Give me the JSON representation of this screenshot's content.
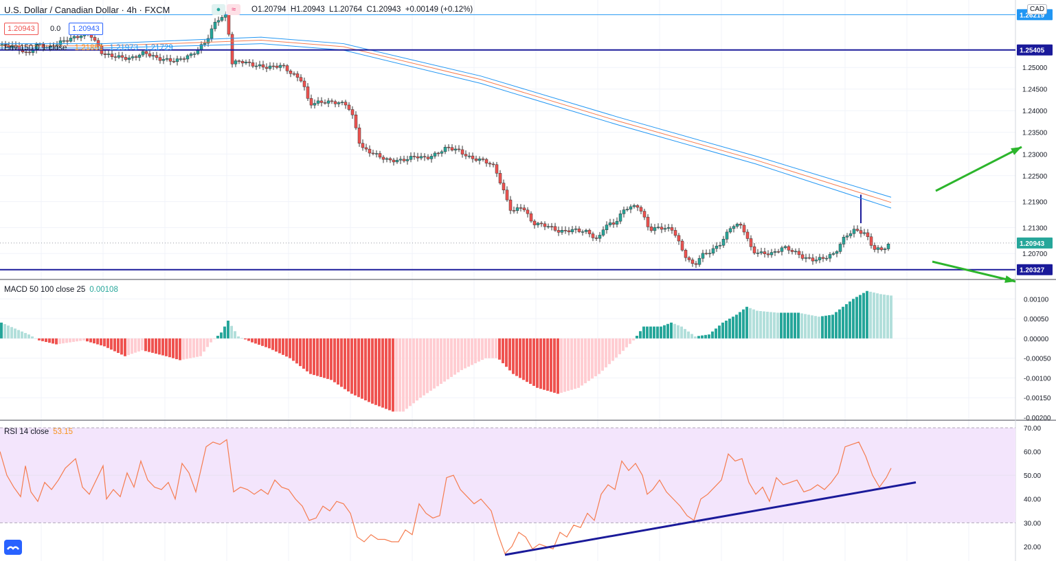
{
  "header": {
    "title": "U.S. Dollar / Canadian Dollar · 4h · FXCM",
    "ohlc_open": "O1.20794",
    "ohlc_high": "H1.20943",
    "ohlc_low": "L1.20764",
    "ohlc_close": "C1.20943",
    "ohlc_change": "+0.00149 (+0.12%)",
    "sell_price": "1.20943",
    "spread": "0.0",
    "buy_price": "1.20943",
    "currency": "CAD"
  },
  "envelope_legend": {
    "label": "Env 150 0.1 close",
    "basis": "1.21851",
    "upper": "1.21973",
    "lower": "1.21729"
  },
  "macd_legend": {
    "label": "MACD 50 100 close 25",
    "value": "0.00108"
  },
  "rsi_legend": {
    "label": "RSI 14 close",
    "value": "53.15"
  },
  "colors": {
    "up": "#26a69a",
    "down": "#ef5350",
    "upper_band": "#2196f3",
    "basis": "#f57c4f",
    "hline_blue": "#1a1a9a",
    "hline_light": "#2196f3",
    "arrow": "#2cb52c",
    "macd_up_strong": "#26a69a",
    "macd_up_weak": "#b2dfdb",
    "macd_down_strong": "#ef5350",
    "macd_down_weak": "#ffcdd2",
    "rsi_line": "#f57c4f",
    "rsi_band": "#f3e5fc",
    "trendline": "#1a1a9a"
  },
  "chart_data": [
    {
      "type": "candlestick",
      "title": "U.S. Dollar / Canadian Dollar · 4h · FXCM",
      "y_axis_ticks": [
        "1.26219",
        "1.25405",
        "1.25000",
        "1.24500",
        "1.24000",
        "1.23500",
        "1.23000",
        "1.22500",
        "1.21900",
        "1.21300",
        "1.20943",
        "1.20700",
        "1.20327"
      ],
      "ylim": [
        1.201,
        1.264
      ],
      "horizontal_levels": [
        {
          "label": "1.26219",
          "value": 1.26219,
          "style": "thin-blue"
        },
        {
          "label": "1.25405",
          "value": 1.25405,
          "style": "thick-navy"
        },
        {
          "label": "1.20327",
          "value": 1.20327,
          "style": "thick-navy"
        }
      ],
      "last_price": "1.20943",
      "close_path": [
        [
          0,
          1.255
        ],
        [
          20,
          1.255
        ],
        [
          40,
          1.253
        ],
        [
          55,
          1.2555
        ],
        [
          70,
          1.2545
        ],
        [
          90,
          1.256
        ],
        [
          110,
          1.257
        ],
        [
          130,
          1.258
        ],
        [
          150,
          1.253
        ],
        [
          170,
          1.2525
        ],
        [
          190,
          1.252
        ],
        [
          210,
          1.2535
        ],
        [
          230,
          1.252
        ],
        [
          255,
          1.2515
        ],
        [
          280,
          1.253
        ],
        [
          300,
          1.256
        ],
        [
          315,
          1.261
        ],
        [
          330,
          1.262
        ],
        [
          338,
          1.251
        ],
        [
          350,
          1.2515
        ],
        [
          370,
          1.2505
        ],
        [
          390,
          1.25
        ],
        [
          410,
          1.2505
        ],
        [
          425,
          1.2485
        ],
        [
          440,
          1.247
        ],
        [
          450,
          1.2415
        ],
        [
          465,
          1.242
        ],
        [
          485,
          1.242
        ],
        [
          505,
          1.2415
        ],
        [
          515,
          1.238
        ],
        [
          525,
          1.2315
        ],
        [
          545,
          1.23
        ],
        [
          565,
          1.2285
        ],
        [
          585,
          1.2285
        ],
        [
          605,
          1.2295
        ],
        [
          620,
          1.229
        ],
        [
          635,
          1.23
        ],
        [
          650,
          1.2315
        ],
        [
          665,
          1.231
        ],
        [
          685,
          1.229
        ],
        [
          705,
          1.2285
        ],
        [
          720,
          1.227
        ],
        [
          735,
          1.2205
        ],
        [
          745,
          1.2165
        ],
        [
          760,
          1.218
        ],
        [
          775,
          1.214
        ],
        [
          795,
          1.2135
        ],
        [
          815,
          1.212
        ],
        [
          835,
          1.2125
        ],
        [
          855,
          1.212
        ],
        [
          870,
          1.21
        ],
        [
          880,
          1.2135
        ],
        [
          895,
          1.214
        ],
        [
          910,
          1.2175
        ],
        [
          930,
          1.218
        ],
        [
          945,
          1.2125
        ],
        [
          960,
          1.213
        ],
        [
          980,
          1.2125
        ],
        [
          995,
          1.207
        ],
        [
          1010,
          1.204
        ],
        [
          1020,
          1.2065
        ],
        [
          1035,
          1.2075
        ],
        [
          1050,
          1.2095
        ],
        [
          1065,
          1.2135
        ],
        [
          1080,
          1.2135
        ],
        [
          1095,
          1.2075
        ],
        [
          1110,
          1.207
        ],
        [
          1125,
          1.207
        ],
        [
          1140,
          1.2085
        ],
        [
          1155,
          1.2075
        ],
        [
          1170,
          1.206
        ],
        [
          1185,
          1.2055
        ],
        [
          1200,
          1.206
        ],
        [
          1215,
          1.207
        ],
        [
          1230,
          1.211
        ],
        [
          1245,
          1.2125
        ],
        [
          1260,
          1.2115
        ],
        [
          1272,
          1.208
        ],
        [
          1285,
          1.208
        ],
        [
          1297,
          1.2094
        ]
      ],
      "envelope": {
        "upper": [
          [
            0,
            1.2555
          ],
          [
            150,
            1.2555
          ],
          [
            300,
            1.2565
          ],
          [
            380,
            1.257
          ],
          [
            500,
            1.2555
          ],
          [
            700,
            1.248
          ],
          [
            900,
            1.2385
          ],
          [
            1100,
            1.2295
          ],
          [
            1297,
            1.22
          ]
        ],
        "basis": [
          [
            0,
            1.255
          ],
          [
            150,
            1.255
          ],
          [
            300,
            1.2558
          ],
          [
            380,
            1.2563
          ],
          [
            500,
            1.2548
          ],
          [
            700,
            1.2472
          ],
          [
            900,
            1.2376
          ],
          [
            1100,
            1.2286
          ],
          [
            1297,
            1.2188
          ]
        ],
        "lower": [
          [
            0,
            1.2545
          ],
          [
            150,
            1.2545
          ],
          [
            300,
            1.2551
          ],
          [
            380,
            1.2555
          ],
          [
            500,
            1.254
          ],
          [
            700,
            1.2463
          ],
          [
            900,
            1.2367
          ],
          [
            1100,
            1.2277
          ],
          [
            1297,
            1.2175
          ]
        ]
      }
    },
    {
      "type": "bar",
      "title": "MACD 50 100 close 25",
      "y_axis_ticks": [
        "0.00100",
        "0.00050",
        "0.00000",
        "-0.00050",
        "-0.00100",
        "-0.00150",
        "-0.00200"
      ],
      "ylim": [
        -0.002,
        0.0013
      ],
      "path": [
        [
          0,
          0.0004
        ],
        [
          40,
          0.0001
        ],
        [
          55,
          -5e-05
        ],
        [
          80,
          -0.00015
        ],
        [
          100,
          -0.0001
        ],
        [
          120,
          -5e-05
        ],
        [
          150,
          -0.0002
        ],
        [
          180,
          -0.00045
        ],
        [
          205,
          -0.0003
        ],
        [
          240,
          -0.00045
        ],
        [
          260,
          -0.00055
        ],
        [
          290,
          -0.00045
        ],
        [
          305,
          -0.0001
        ],
        [
          320,
          0.00015
        ],
        [
          330,
          0.00045
        ],
        [
          345,
          5e-05
        ],
        [
          365,
          -0.0001
        ],
        [
          390,
          -0.00025
        ],
        [
          420,
          -0.0005
        ],
        [
          450,
          -0.0009
        ],
        [
          480,
          -0.00105
        ],
        [
          510,
          -0.0014
        ],
        [
          540,
          -0.00165
        ],
        [
          570,
          -0.00185
        ],
        [
          585,
          -0.00185
        ],
        [
          610,
          -0.0015
        ],
        [
          640,
          -0.00115
        ],
        [
          670,
          -0.0008
        ],
        [
          705,
          -0.0005
        ],
        [
          723,
          -0.0005
        ],
        [
          745,
          -0.0009
        ],
        [
          780,
          -0.00125
        ],
        [
          810,
          -0.0014
        ],
        [
          840,
          -0.00125
        ],
        [
          870,
          -0.0009
        ],
        [
          900,
          -0.0004
        ],
        [
          920,
          -5e-05
        ],
        [
          935,
          0.0003
        ],
        [
          960,
          0.0003
        ],
        [
          975,
          0.0004
        ],
        [
          990,
          0.0003
        ],
        [
          1010,
          5e-05
        ],
        [
          1030,
          0.0001
        ],
        [
          1050,
          0.0004
        ],
        [
          1070,
          0.0006
        ],
        [
          1085,
          0.0008
        ],
        [
          1100,
          0.0007
        ],
        [
          1130,
          0.00065
        ],
        [
          1160,
          0.00065
        ],
        [
          1190,
          0.00055
        ],
        [
          1210,
          0.0006
        ],
        [
          1225,
          0.0008
        ],
        [
          1240,
          0.001
        ],
        [
          1260,
          0.0012
        ],
        [
          1280,
          0.00112
        ],
        [
          1297,
          0.00108
        ]
      ]
    },
    {
      "type": "line",
      "title": "RSI 14 close",
      "y_axis_ticks": [
        "70.00",
        "60.00",
        "50.00",
        "40.00",
        "30.00",
        "20.00"
      ],
      "ylim": [
        16.5,
        70.0
      ],
      "band": [
        30,
        70
      ],
      "values": [
        [
          0,
          60
        ],
        [
          10,
          50
        ],
        [
          20,
          45
        ],
        [
          30,
          41
        ],
        [
          37,
          54
        ],
        [
          45,
          43
        ],
        [
          55,
          39
        ],
        [
          65,
          47
        ],
        [
          75,
          44
        ],
        [
          85,
          48
        ],
        [
          95,
          53
        ],
        [
          110,
          57
        ],
        [
          120,
          45
        ],
        [
          130,
          42
        ],
        [
          140,
          48
        ],
        [
          150,
          54
        ],
        [
          155,
          40
        ],
        [
          165,
          44
        ],
        [
          175,
          41
        ],
        [
          185,
          51
        ],
        [
          195,
          45
        ],
        [
          205,
          56
        ],
        [
          215,
          48
        ],
        [
          225,
          45
        ],
        [
          235,
          44
        ],
        [
          245,
          47
        ],
        [
          255,
          40
        ],
        [
          265,
          55
        ],
        [
          275,
          51
        ],
        [
          285,
          43
        ],
        [
          300,
          62
        ],
        [
          310,
          64
        ],
        [
          320,
          63
        ],
        [
          330,
          65
        ],
        [
          340,
          43
        ],
        [
          350,
          45
        ],
        [
          360,
          44
        ],
        [
          370,
          42
        ],
        [
          380,
          44
        ],
        [
          390,
          42
        ],
        [
          400,
          48
        ],
        [
          410,
          45
        ],
        [
          420,
          44
        ],
        [
          430,
          40
        ],
        [
          440,
          37
        ],
        [
          450,
          31
        ],
        [
          460,
          32
        ],
        [
          470,
          37
        ],
        [
          480,
          35
        ],
        [
          490,
          39
        ],
        [
          500,
          38
        ],
        [
          510,
          34
        ],
        [
          520,
          24
        ],
        [
          530,
          22
        ],
        [
          540,
          25
        ],
        [
          550,
          23
        ],
        [
          560,
          23
        ],
        [
          570,
          22
        ],
        [
          580,
          22
        ],
        [
          590,
          27
        ],
        [
          600,
          25
        ],
        [
          610,
          38
        ],
        [
          620,
          34
        ],
        [
          630,
          32
        ],
        [
          640,
          33
        ],
        [
          650,
          49
        ],
        [
          660,
          50
        ],
        [
          670,
          44
        ],
        [
          680,
          41
        ],
        [
          690,
          38
        ],
        [
          700,
          40
        ],
        [
          715,
          35
        ],
        [
          725,
          25
        ],
        [
          735,
          17
        ],
        [
          745,
          20
        ],
        [
          755,
          26
        ],
        [
          765,
          24
        ],
        [
          775,
          19
        ],
        [
          785,
          21
        ],
        [
          795,
          20
        ],
        [
          805,
          19
        ],
        [
          815,
          26
        ],
        [
          825,
          24
        ],
        [
          835,
          29
        ],
        [
          845,
          28
        ],
        [
          855,
          34
        ],
        [
          865,
          31
        ],
        [
          875,
          42
        ],
        [
          885,
          46
        ],
        [
          895,
          44
        ],
        [
          905,
          56
        ],
        [
          915,
          52
        ],
        [
          925,
          55
        ],
        [
          935,
          50
        ],
        [
          942,
          42
        ],
        [
          950,
          44
        ],
        [
          960,
          48
        ],
        [
          970,
          43
        ],
        [
          980,
          40
        ],
        [
          990,
          37
        ],
        [
          1000,
          33
        ],
        [
          1010,
          31
        ],
        [
          1020,
          40
        ],
        [
          1030,
          42
        ],
        [
          1040,
          45
        ],
        [
          1050,
          48
        ],
        [
          1060,
          59
        ],
        [
          1070,
          56
        ],
        [
          1080,
          57
        ],
        [
          1090,
          47
        ],
        [
          1100,
          42
        ],
        [
          1110,
          45
        ],
        [
          1120,
          39
        ],
        [
          1130,
          49
        ],
        [
          1140,
          46
        ],
        [
          1150,
          47
        ],
        [
          1160,
          48
        ],
        [
          1170,
          43
        ],
        [
          1180,
          44
        ],
        [
          1190,
          46
        ],
        [
          1200,
          44
        ],
        [
          1210,
          47
        ],
        [
          1220,
          51
        ],
        [
          1230,
          62
        ],
        [
          1240,
          63
        ],
        [
          1250,
          64
        ],
        [
          1260,
          58
        ],
        [
          1270,
          50
        ],
        [
          1280,
          45
        ],
        [
          1290,
          49
        ],
        [
          1297,
          53
        ]
      ],
      "trendline": [
        [
          735,
          16.5
        ],
        [
          1333,
          47.0
        ]
      ]
    }
  ]
}
